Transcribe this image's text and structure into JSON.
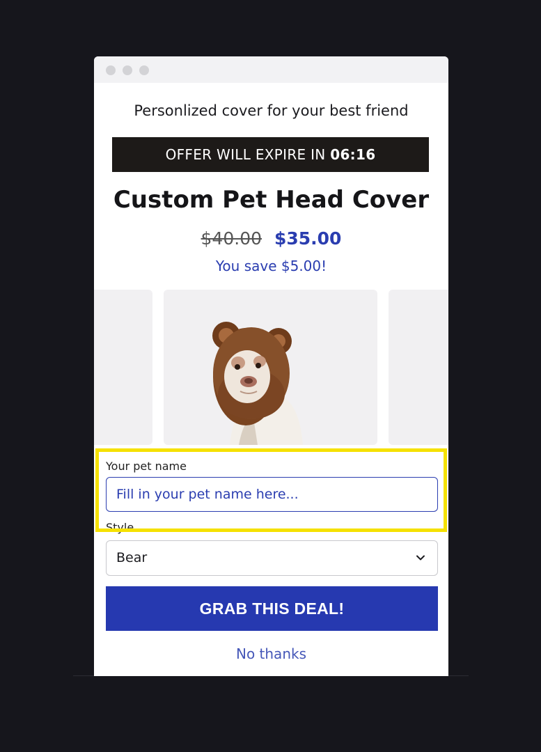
{
  "popup": {
    "tagline": "Personlized cover for your best friend",
    "offer_prefix": "OFFER WILL EXPIRE IN",
    "offer_time": "06:16",
    "product_title": "Custom Pet Head Cover",
    "old_price": "$40.00",
    "new_price": "$35.00",
    "savings": "You save $5.00!"
  },
  "form": {
    "pet_name_label": "Your pet name",
    "pet_name_placeholder": "Fill in your pet name here...",
    "style_label": "Style",
    "style_value": "Bear"
  },
  "actions": {
    "grab_label": "GRAB THIS DEAL!",
    "no_thanks_label": "No thanks"
  },
  "colors": {
    "accent": "#2639b0",
    "timer_bg": "#1d1a18",
    "highlight": "#f5e100"
  },
  "icons": [
    "chevron-down-icon",
    "window-dot-icon"
  ]
}
